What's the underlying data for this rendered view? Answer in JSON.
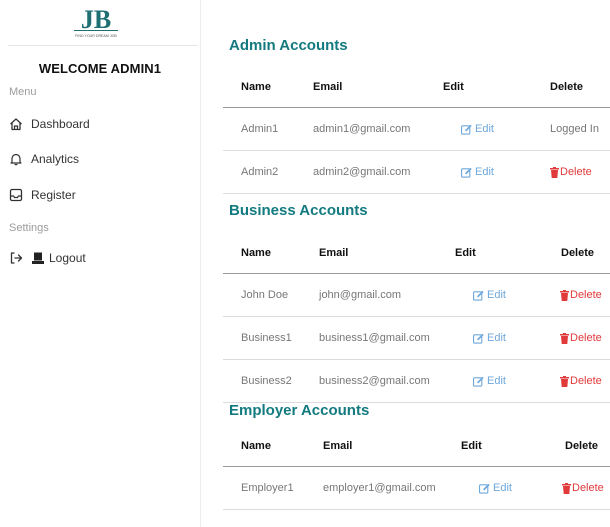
{
  "sidebar": {
    "logo_text": "JB",
    "logo_tagline": "FIND YOUR DREAM JOB",
    "welcome": "WELCOME ADMIN1",
    "menu_label": "Menu",
    "settings_label": "Settings",
    "items": [
      {
        "label": "Dashboard",
        "icon": "home-icon"
      },
      {
        "label": "Analytics",
        "icon": "bell-icon"
      },
      {
        "label": "Register",
        "icon": "inbox-icon"
      }
    ],
    "logout_label": "Logout"
  },
  "admin": {
    "title": "Admin Accounts",
    "headers": {
      "name": "Name",
      "email": "Email",
      "edit": "Edit",
      "delete": "Delete"
    },
    "rows": [
      {
        "name": "Admin1",
        "email": "admin1@gmail.com",
        "edit": "Edit",
        "delete": "Logged In"
      },
      {
        "name": "Admin2",
        "email": "admin2@gmail.com",
        "edit": "Edit",
        "delete": "Delete"
      }
    ]
  },
  "business": {
    "title": "Business Accounts",
    "headers": {
      "name": "Name",
      "email": "Email",
      "edit": "Edit",
      "delete": "Delete"
    },
    "rows": [
      {
        "name": "John Doe",
        "email": "john@gmail.com",
        "edit": "Edit",
        "delete": "Delete"
      },
      {
        "name": "Business1",
        "email": "business1@gmail.com",
        "edit": "Edit",
        "delete": "Delete"
      },
      {
        "name": "Business2",
        "email": "business2@gmail.com",
        "edit": "Edit",
        "delete": "Delete"
      }
    ]
  },
  "employer": {
    "title": "Employer Accounts",
    "headers": {
      "name": "Name",
      "email": "Email",
      "edit": "Edit",
      "delete": "Delete"
    },
    "rows": [
      {
        "name": "Employer1",
        "email": "employer1@gmail.com",
        "edit": "Edit",
        "delete": "Delete"
      }
    ]
  },
  "colors": {
    "accent": "#137a7f",
    "edit": "#6fa8dc",
    "delete": "#e03a3a"
  }
}
